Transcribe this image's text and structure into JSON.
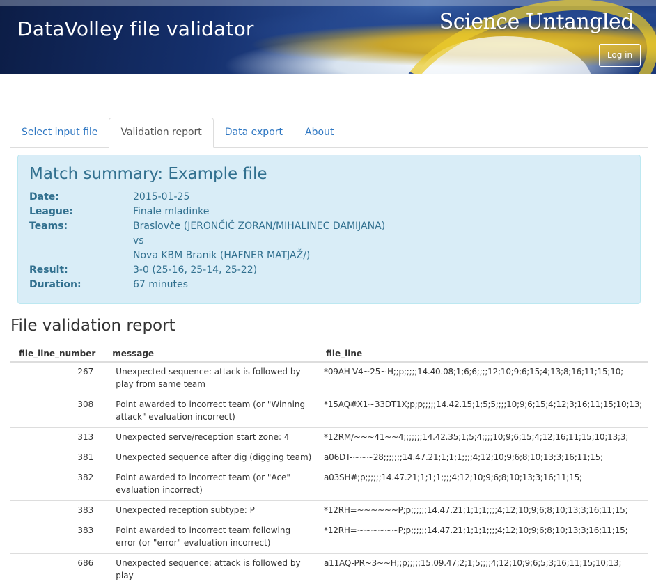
{
  "header": {
    "app_title": "DataVolley file validator",
    "brand": "Science Untangled",
    "login_label": "Log in"
  },
  "tabs": [
    {
      "label": "Select input file",
      "active": false
    },
    {
      "label": "Validation report",
      "active": true
    },
    {
      "label": "Data export",
      "active": false
    },
    {
      "label": "About",
      "active": false
    }
  ],
  "summary": {
    "title": "Match summary: Example file",
    "date_label": "Date:",
    "date": "2015-01-25",
    "league_label": "League:",
    "league": "Finale mladinke",
    "teams_label": "Teams:",
    "team_home": "Braslovče (JERONČIČ ZORAN/MIHALINEC DAMIJANA)",
    "vs": "vs",
    "team_away": "Nova KBM Branik (HAFNER MATJAŽ/)",
    "result_label": "Result:",
    "result": "3-0 (25-16, 25-14, 25-22)",
    "duration_label": "Duration:",
    "duration": "67 minutes"
  },
  "report": {
    "title": "File validation report",
    "columns": [
      "file_line_number",
      "message",
      "file_line"
    ],
    "rows": [
      {
        "n": "267",
        "message": "Unexpected sequence: attack is followed by play from same team",
        "line": "*09AH-V4~25~H;;p;;;;;14.40.08;1;6;6;;;;12;10;9;6;15;4;13;8;16;11;15;10;"
      },
      {
        "n": "308",
        "message": "Point awarded to incorrect team (or \"Winning attack\" evaluation incorrect)",
        "line": "*15AQ#X1~33DT1X;p;p;;;;;14.42.15;1;5;5;;;;10;9;6;15;4;12;3;16;11;15;10;13;"
      },
      {
        "n": "313",
        "message": "Unexpected serve/reception start zone: 4",
        "line": "*12RM/~~~41~~4;;;;;;;14.42.35;1;5;4;;;;10;9;6;15;4;12;16;11;15;10;13;3;"
      },
      {
        "n": "381",
        "message": "Unexpected sequence after dig (digging team)",
        "line": "a06DT-~~~28;;;;;;;14.47.21;1;1;1;;;;4;12;10;9;6;8;10;13;3;16;11;15;"
      },
      {
        "n": "382",
        "message": "Point awarded to incorrect team (or \"Ace\" evaluation incorrect)",
        "line": "a03SH#;p;;;;;;14.47.21;1;1;1;;;;4;12;10;9;6;8;10;13;3;16;11;15;"
      },
      {
        "n": "383",
        "message": "Unexpected reception subtype: P",
        "line": "*12RH=~~~~~~P;p;;;;;;14.47.21;1;1;1;;;;4;12;10;9;6;8;10;13;3;16;11;15;"
      },
      {
        "n": "383",
        "message": "Point awarded to incorrect team following error (or \"error\" evaluation incorrect)",
        "line": "*12RH=~~~~~~P;p;;;;;;14.47.21;1;1;1;;;;4;12;10;9;6;8;10;13;3;16;11;15;"
      },
      {
        "n": "686",
        "message": "Unexpected sequence: attack is followed by play",
        "line": "a11AQ-PR~3~~H;;p;;;;;15.09.47;2;1;5;;;;4;12;10;9;6;5;3;16;11;15;10;13;"
      }
    ]
  }
}
